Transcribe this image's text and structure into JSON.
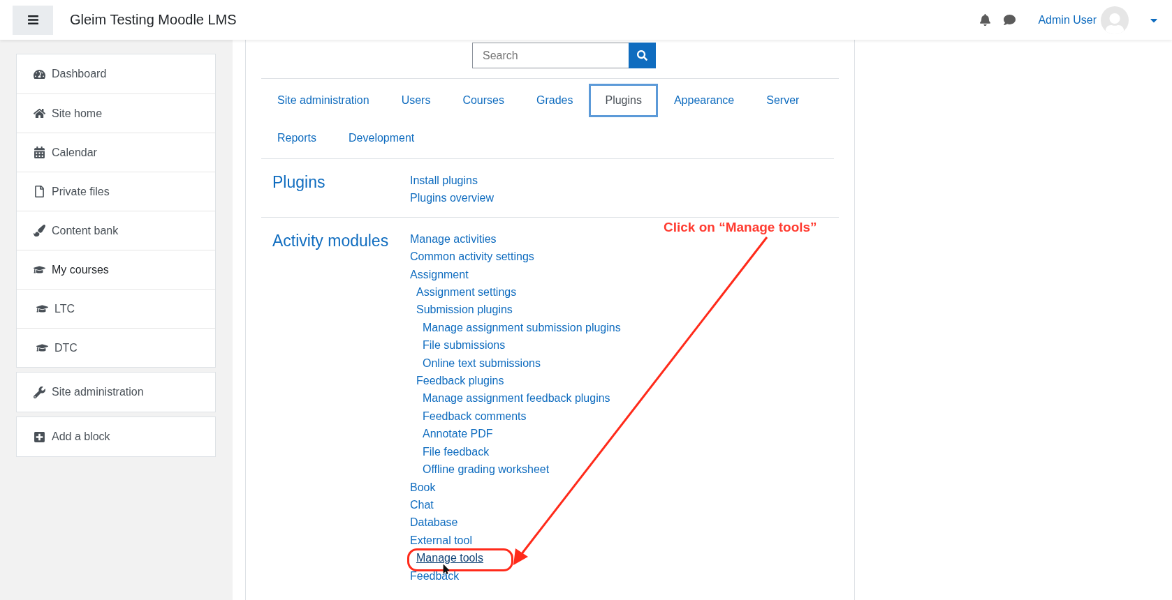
{
  "header": {
    "title": "Gleim Testing Moodle LMS",
    "user_name": "Admin User"
  },
  "sidebar": {
    "groups": [
      [
        {
          "label": "Dashboard"
        },
        {
          "label": "Site home"
        },
        {
          "label": "Calendar"
        },
        {
          "label": "Private files"
        },
        {
          "label": "Content bank"
        },
        {
          "label": "My courses",
          "children": [
            {
              "label": "LTC"
            },
            {
              "label": "DTC"
            }
          ]
        }
      ],
      [
        {
          "label": "Site administration"
        }
      ],
      [
        {
          "label": "Add a block"
        }
      ]
    ]
  },
  "search": {
    "placeholder": "Search"
  },
  "tabs": [
    {
      "label": "Site administration",
      "selected": false
    },
    {
      "label": "Users",
      "selected": false
    },
    {
      "label": "Courses",
      "selected": false
    },
    {
      "label": "Grades",
      "selected": false
    },
    {
      "label": "Plugins",
      "selected": true
    },
    {
      "label": "Appearance",
      "selected": false
    },
    {
      "label": "Server",
      "selected": false
    },
    {
      "label": "Reports",
      "selected": false
    },
    {
      "label": "Development",
      "selected": false
    }
  ],
  "sections": [
    {
      "heading": "Plugins",
      "links": [
        {
          "text": "Install plugins"
        },
        {
          "text": "Plugins overview"
        }
      ]
    },
    {
      "heading": "Activity modules",
      "links": [
        {
          "text": "Manage activities"
        },
        {
          "text": "Common activity settings"
        },
        {
          "text": "Assignment",
          "children": [
            {
              "text": "Assignment settings"
            },
            {
              "text": "Submission plugins",
              "children": [
                {
                  "text": "Manage assignment submission plugins"
                },
                {
                  "text": "File submissions"
                },
                {
                  "text": "Online text submissions"
                }
              ]
            },
            {
              "text": "Feedback plugins",
              "children": [
                {
                  "text": "Manage assignment feedback plugins"
                },
                {
                  "text": "Feedback comments"
                },
                {
                  "text": "Annotate PDF"
                },
                {
                  "text": "File feedback"
                },
                {
                  "text": "Offline grading worksheet"
                }
              ]
            }
          ]
        },
        {
          "text": "Book"
        },
        {
          "text": "Chat"
        },
        {
          "text": "Database"
        },
        {
          "text": "External tool",
          "children": [
            {
              "text": "Manage tools",
              "highlighted": true
            }
          ]
        },
        {
          "text": "Feedback"
        }
      ]
    }
  ],
  "annotation": {
    "text": "Click on “Manage tools”"
  }
}
